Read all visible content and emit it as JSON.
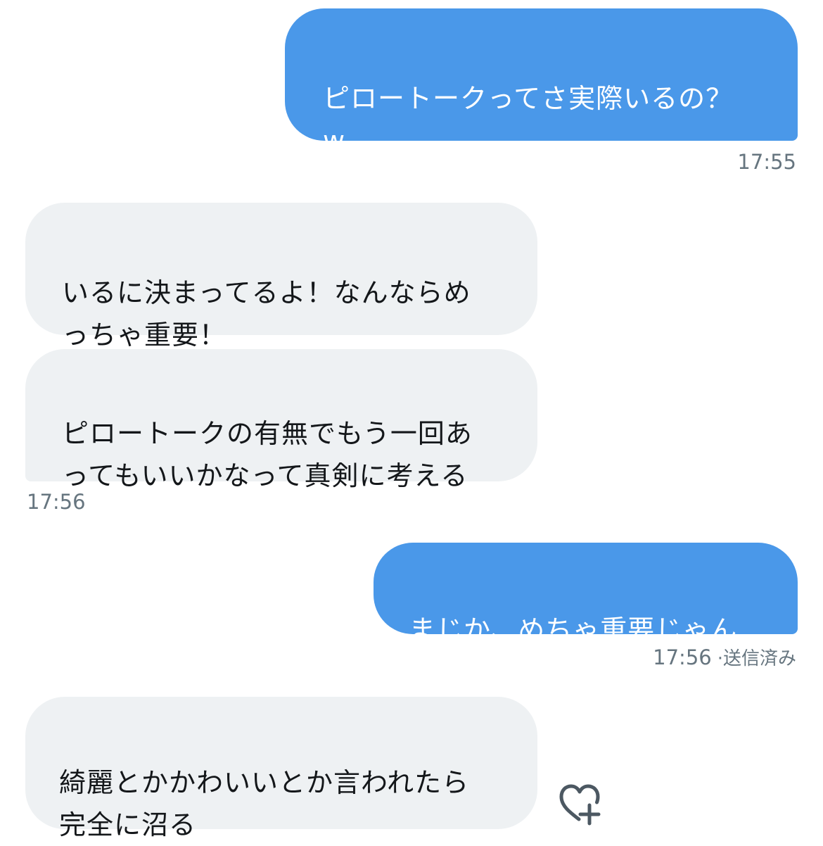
{
  "messages": [
    {
      "id": "m1",
      "direction": "sent",
      "text": "ピロートークってさ実際いるの？\nw"
    },
    {
      "id": "m2",
      "direction": "received",
      "text": "いるに決まってるよ！なんならめ\nっちゃ重要！"
    },
    {
      "id": "m3",
      "direction": "received",
      "text": "ピロートークの有無でもう一回あ\nってもいいかなって真剣に考える"
    },
    {
      "id": "m4",
      "direction": "sent",
      "text": "まじか、めちゃ重要じゃん"
    },
    {
      "id": "m5",
      "direction": "received",
      "text": "綺麗とかかわいいとか言われたら\n完全に沼る"
    }
  ],
  "meta": {
    "m1_time": "17:55",
    "m3_time": "17:56",
    "m4_time": "17:56",
    "m4_status": "·送信済み"
  },
  "icons": {
    "like": "heart-plus-icon"
  },
  "colors": {
    "sent_bubble": "#4a98e9",
    "received_bubble": "#eef1f3",
    "timestamp": "#66757f"
  }
}
